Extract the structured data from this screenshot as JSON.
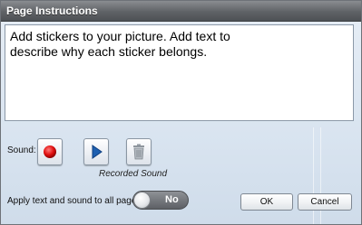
{
  "dialog": {
    "title": "Page Instructions",
    "instructions_text": "Add stickers to your picture. Add text to\ndescribe why each sticker belongs."
  },
  "sound": {
    "label": "Sound:",
    "record_icon": "record-icon",
    "play_icon": "play-icon",
    "delete_icon": "trash-icon",
    "recorded_caption": "Recorded Sound"
  },
  "apply_all": {
    "label": "Apply text and sound to all pages:",
    "toggle_state": "No"
  },
  "buttons": {
    "ok": "OK",
    "cancel": "Cancel"
  },
  "colors": {
    "titlebar": "#5f6266",
    "record_red": "#e01010",
    "play_blue": "#1e5fb0"
  }
}
